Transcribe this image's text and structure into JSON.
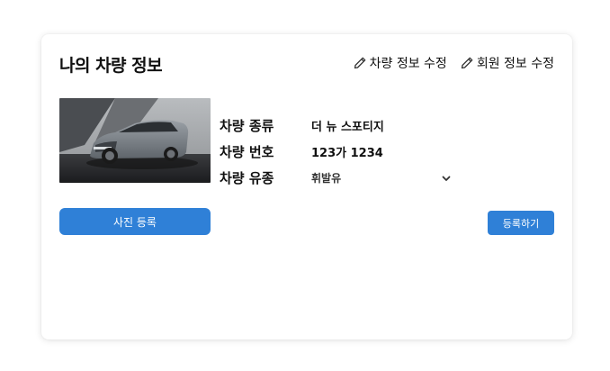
{
  "card": {
    "title": "나의 차량 정보",
    "actions": [
      {
        "label": "차량 정보 수정",
        "icon": "pencil-icon"
      },
      {
        "label": "회원 정보 수정",
        "icon": "pencil-icon"
      }
    ]
  },
  "vehicle": {
    "rows": [
      {
        "label": "차량 종류",
        "value": "더 뉴 스포티지"
      },
      {
        "label": "차량 번호",
        "value": "123가 1234"
      },
      {
        "label": "차량 유종",
        "value": "휘발유"
      }
    ],
    "fuel_dropdown_icon": "chevron-down-icon"
  },
  "buttons": {
    "photo_upload": "사진 등록",
    "register": "등록하기"
  },
  "colors": {
    "accent": "#2f80d7",
    "text": "#111111"
  }
}
